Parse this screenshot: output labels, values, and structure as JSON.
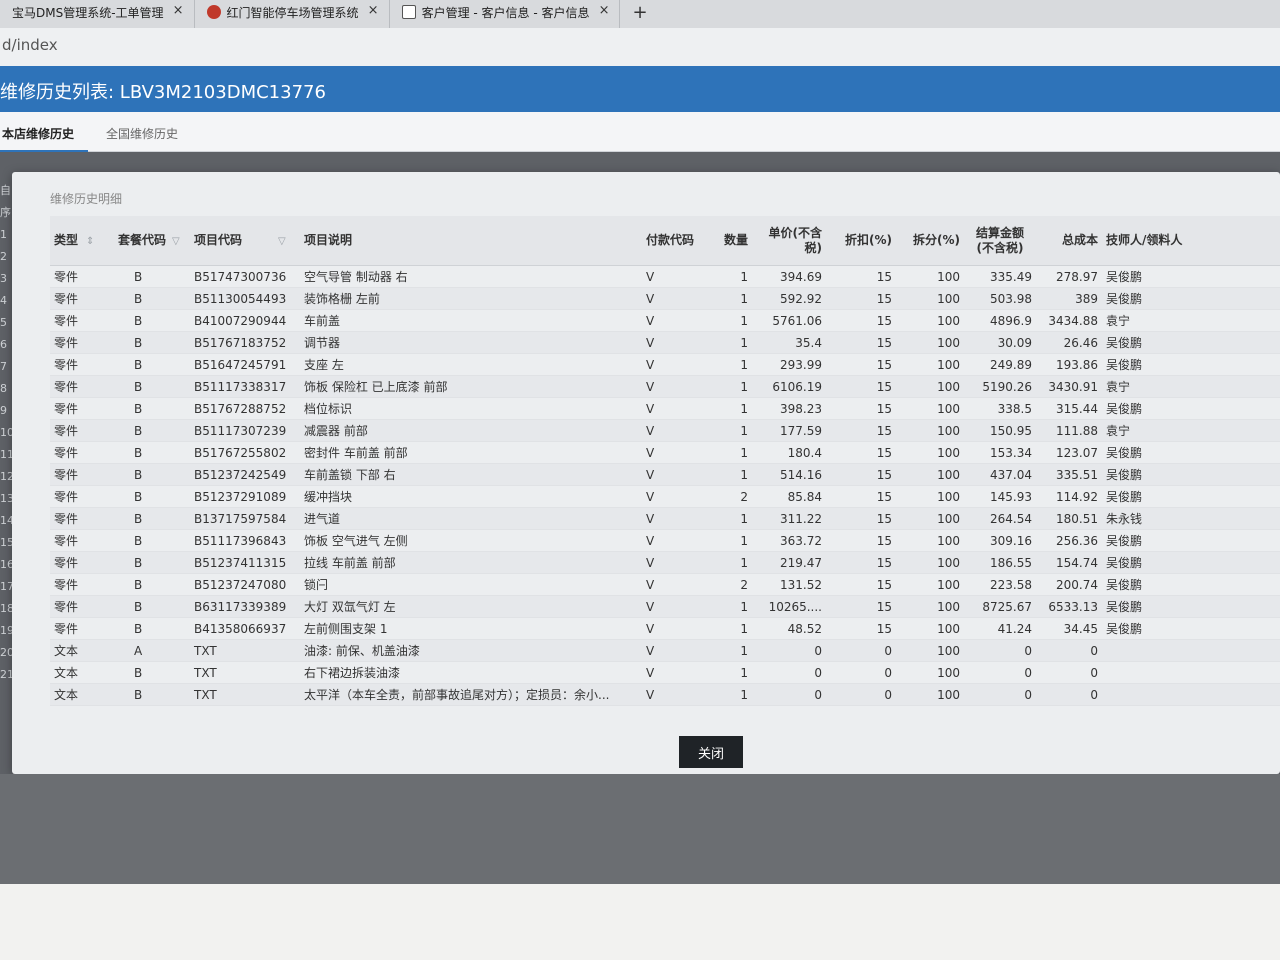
{
  "browser": {
    "tabs": [
      {
        "title": "宝马DMS管理系统-工单管理",
        "icon": "app-icon",
        "close": "×"
      },
      {
        "title": "红门智能停车场管理系统",
        "icon": "gear-icon",
        "close": "×"
      },
      {
        "title": "客户管理 - 客户信息 - 客户信息",
        "icon": "chart-icon",
        "close": "×"
      }
    ],
    "new_tab": "+",
    "address": "d/index"
  },
  "header": {
    "title": "维修历史列表: LBV3M2103DMC13776"
  },
  "nav_tabs": [
    {
      "label": "本店维修历史",
      "active": true
    },
    {
      "label": "全国维修历史",
      "active": false
    }
  ],
  "gutter": [
    "自",
    "序",
    "1",
    "2",
    "3",
    "4",
    "5",
    "6",
    "7",
    "8",
    "9",
    "10",
    "11",
    "12",
    "13",
    "14",
    "15",
    "16",
    "17",
    "18",
    "19",
    "20",
    "21"
  ],
  "modal": {
    "subtitle": "维修历史明细",
    "columns": {
      "type": "类型",
      "package_code": "套餐代码",
      "item_code": "项目代码",
      "item_desc": "项目说明",
      "pay_code": "付款代码",
      "qty": "数量",
      "unit_price": "单价(不含税)",
      "discount": "折扣(%)",
      "split": "拆分(%)",
      "settle": "结算金额(不含税)",
      "total_cost": "总成本",
      "technician": "技师人/领料人"
    },
    "rows": [
      [
        "零件",
        "B",
        "B51747300736",
        "空气导管 制动器 右",
        "V",
        "1",
        "394.69",
        "15",
        "100",
        "335.49",
        "278.97",
        "吴俊鹏"
      ],
      [
        "零件",
        "B",
        "B51130054493",
        "装饰格栅 左前",
        "V",
        "1",
        "592.92",
        "15",
        "100",
        "503.98",
        "389",
        "吴俊鹏"
      ],
      [
        "零件",
        "B",
        "B41007290944",
        "车前盖",
        "V",
        "1",
        "5761.06",
        "15",
        "100",
        "4896.9",
        "3434.88",
        "袁宁"
      ],
      [
        "零件",
        "B",
        "B51767183752",
        "调节器",
        "V",
        "1",
        "35.4",
        "15",
        "100",
        "30.09",
        "26.46",
        "吴俊鹏"
      ],
      [
        "零件",
        "B",
        "B51647245791",
        "支座 左",
        "V",
        "1",
        "293.99",
        "15",
        "100",
        "249.89",
        "193.86",
        "吴俊鹏"
      ],
      [
        "零件",
        "B",
        "B51117338317",
        "饰板 保险杠 已上底漆 前部",
        "V",
        "1",
        "6106.19",
        "15",
        "100",
        "5190.26",
        "3430.91",
        "袁宁"
      ],
      [
        "零件",
        "B",
        "B51767288752",
        "档位标识",
        "V",
        "1",
        "398.23",
        "15",
        "100",
        "338.5",
        "315.44",
        "吴俊鹏"
      ],
      [
        "零件",
        "B",
        "B51117307239",
        "减震器 前部",
        "V",
        "1",
        "177.59",
        "15",
        "100",
        "150.95",
        "111.88",
        "袁宁"
      ],
      [
        "零件",
        "B",
        "B51767255802",
        "密封件 车前盖 前部",
        "V",
        "1",
        "180.4",
        "15",
        "100",
        "153.34",
        "123.07",
        "吴俊鹏"
      ],
      [
        "零件",
        "B",
        "B51237242549",
        "车前盖锁 下部 右",
        "V",
        "1",
        "514.16",
        "15",
        "100",
        "437.04",
        "335.51",
        "吴俊鹏"
      ],
      [
        "零件",
        "B",
        "B51237291089",
        "缓冲挡块",
        "V",
        "2",
        "85.84",
        "15",
        "100",
        "145.93",
        "114.92",
        "吴俊鹏"
      ],
      [
        "零件",
        "B",
        "B13717597584",
        "进气道",
        "V",
        "1",
        "311.22",
        "15",
        "100",
        "264.54",
        "180.51",
        "朱永钱"
      ],
      [
        "零件",
        "B",
        "B51117396843",
        "饰板 空气进气 左侧",
        "V",
        "1",
        "363.72",
        "15",
        "100",
        "309.16",
        "256.36",
        "吴俊鹏"
      ],
      [
        "零件",
        "B",
        "B51237411315",
        "拉线 车前盖 前部",
        "V",
        "1",
        "219.47",
        "15",
        "100",
        "186.55",
        "154.74",
        "吴俊鹏"
      ],
      [
        "零件",
        "B",
        "B51237247080",
        "锁闩",
        "V",
        "2",
        "131.52",
        "15",
        "100",
        "223.58",
        "200.74",
        "吴俊鹏"
      ],
      [
        "零件",
        "B",
        "B63117339389",
        "大灯 双氙气灯 左",
        "V",
        "1",
        "10265....",
        "15",
        "100",
        "8725.67",
        "6533.13",
        "吴俊鹏"
      ],
      [
        "零件",
        "B",
        "B41358066937",
        "左前侧围支架 1",
        "V",
        "1",
        "48.52",
        "15",
        "100",
        "41.24",
        "34.45",
        "吴俊鹏"
      ],
      [
        "文本",
        "A",
        "TXT",
        "油漆: 前保、机盖油漆",
        "V",
        "1",
        "0",
        "0",
        "100",
        "0",
        "0",
        ""
      ],
      [
        "文本",
        "B",
        "TXT",
        "右下裙边拆装油漆",
        "V",
        "1",
        "0",
        "0",
        "100",
        "0",
        "0",
        ""
      ],
      [
        "文本",
        "B",
        "TXT",
        "太平洋（本车全责，前部事故追尾对方）；定损员：余小...",
        "V",
        "1",
        "0",
        "0",
        "100",
        "0",
        "0",
        ""
      ]
    ],
    "close_label": "关闭"
  }
}
